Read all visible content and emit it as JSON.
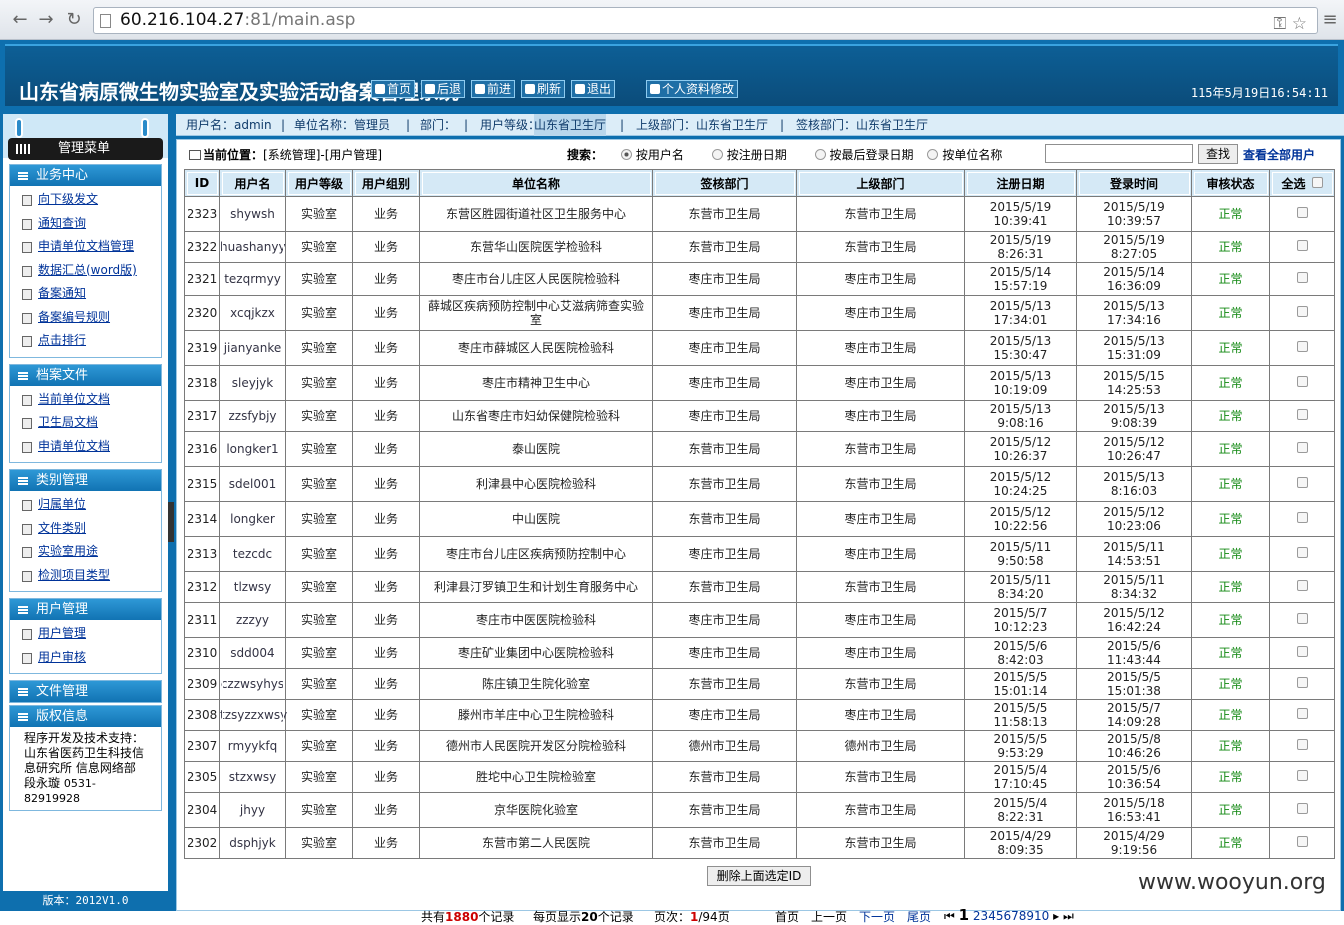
{
  "browser": {
    "url_host": "60.216.104.27",
    "url_rest": ":81/main.asp"
  },
  "header": {
    "title": "山东省病原微生物实验室及实验活动备案管理系统",
    "buttons": [
      "首页",
      "后退",
      "前进",
      "刷新",
      "退出"
    ],
    "profile_button": "个人资料修改",
    "time": "115年5月19日16:54:11"
  },
  "sidebar": {
    "menu_title": "管理菜单",
    "groups": [
      {
        "title": "业务中心",
        "items": [
          "向下级发文",
          "通知查询",
          "申请单位文档管理",
          "数据汇总(word版)",
          "备案通知",
          "备案编号规则",
          "点击排行"
        ]
      },
      {
        "title": "档案文件",
        "items": [
          "当前单位文档",
          "卫生局文档",
          "申请单位文档"
        ]
      },
      {
        "title": "类别管理",
        "items": [
          "归属单位",
          "文件类别",
          "实验室用途",
          "检测项目类型"
        ]
      },
      {
        "title": "用户管理",
        "items": [
          "用户管理",
          "用户审核"
        ]
      },
      {
        "title": "文件管理",
        "items": []
      },
      {
        "title": "版权信息",
        "items": []
      }
    ],
    "credit": "程序开发及技术支持：山东省医药卫生科技信息研究所 信息网络部 段永璇",
    "phone": "0531-82919928",
    "version": "版本：2012V1.0"
  },
  "info": {
    "username": "用户名：admin",
    "unit_name": "单位名称：管理员",
    "dept": "部门：",
    "level_label": "用户等级：",
    "level": "山东省卫生厅",
    "parent_dept": "上级部门：山东省卫生厅",
    "sign_dept": "签核部门：山东省卫生厅"
  },
  "main": {
    "loc_label": "当前位置：",
    "loc_path": "[系统管理]-[用户管理]",
    "search_label": "搜索：",
    "search_options": [
      "按用户名",
      "按注册日期",
      "按最后登录日期",
      "按单位名称"
    ],
    "search_button": "查找",
    "view_all": "查看全部用户",
    "delete_button": "删除上面选定ID"
  },
  "table": {
    "headers": [
      "ID",
      "用户名",
      "用户等级",
      "用户组别",
      "单位名称",
      "签核部门",
      "上级部门",
      "注册日期",
      "登录时间",
      "审核状态",
      "全选"
    ],
    "rows": [
      [
        "2323",
        "shywsh",
        "实验室",
        "业务",
        "东营区胜园街道社区卫生服务中心",
        "东营市卫生局",
        "东营市卫生局",
        "2015/5/19 10:39:41",
        "2015/5/19 10:39:57",
        "正常"
      ],
      [
        "2322",
        "huashanyy",
        "实验室",
        "业务",
        "东营华山医院医学检验科",
        "东营市卫生局",
        "东营市卫生局",
        "2015/5/19 8:26:31",
        "2015/5/19 8:27:05",
        "正常"
      ],
      [
        "2321",
        "tezqrmyy",
        "实验室",
        "业务",
        "枣庄市台儿庄区人民医院检验科",
        "枣庄市卫生局",
        "枣庄市卫生局",
        "2015/5/14 15:57:19",
        "2015/5/14 16:36:09",
        "正常"
      ],
      [
        "2320",
        "xcqjkzx",
        "实验室",
        "业务",
        "薛城区疾病预防控制中心艾滋病筛查实验室",
        "枣庄市卫生局",
        "枣庄市卫生局",
        "2015/5/13 17:34:01",
        "2015/5/13 17:34:16",
        "正常"
      ],
      [
        "2319",
        "jianyanke",
        "实验室",
        "业务",
        "枣庄市薛城区人民医院检验科",
        "枣庄市卫生局",
        "枣庄市卫生局",
        "2015/5/13 15:30:47",
        "2015/5/13 15:31:09",
        "正常"
      ],
      [
        "2318",
        "sleyjyk",
        "实验室",
        "业务",
        "枣庄市精神卫生中心",
        "枣庄市卫生局",
        "枣庄市卫生局",
        "2015/5/13 10:19:09",
        "2015/5/15 14:25:53",
        "正常"
      ],
      [
        "2317",
        "zzsfybjy",
        "实验室",
        "业务",
        "山东省枣庄市妇幼保健院检验科",
        "枣庄市卫生局",
        "枣庄市卫生局",
        "2015/5/13 9:08:16",
        "2015/5/13 9:08:39",
        "正常"
      ],
      [
        "2316",
        "longker1",
        "实验室",
        "业务",
        "泰山医院",
        "东营市卫生局",
        "东营市卫生局",
        "2015/5/12 10:26:37",
        "2015/5/12 10:26:47",
        "正常"
      ],
      [
        "2315",
        "sdel001",
        "实验室",
        "业务",
        "利津县中心医院检验科",
        "东营市卫生局",
        "东营市卫生局",
        "2015/5/12 10:24:25",
        "2015/5/13 8:16:03",
        "正常"
      ],
      [
        "2314",
        "longker",
        "实验室",
        "业务",
        "中山医院",
        "东营市卫生局",
        "枣庄市卫生局",
        "2015/5/12 10:22:56",
        "2015/5/12 10:23:06",
        "正常"
      ],
      [
        "2313",
        "tezcdc",
        "实验室",
        "业务",
        "枣庄市台儿庄区疾病预防控制中心",
        "枣庄市卫生局",
        "枣庄市卫生局",
        "2015/5/11 9:50:58",
        "2015/5/11 14:53:51",
        "正常"
      ],
      [
        "2312",
        "tlzwsy",
        "实验室",
        "业务",
        "利津县汀罗镇卫生和计划生育服务中心",
        "东营市卫生局",
        "东营市卫生局",
        "2015/5/11 8:34:20",
        "2015/5/11 8:34:32",
        "正常"
      ],
      [
        "2311",
        "zzzyy",
        "实验室",
        "业务",
        "枣庄市中医医院检验科",
        "枣庄市卫生局",
        "枣庄市卫生局",
        "2015/5/7 10:12:23",
        "2015/5/12 16:42:24",
        "正常"
      ],
      [
        "2310",
        "sdd004",
        "实验室",
        "业务",
        "枣庄矿业集团中心医院检验科",
        "枣庄市卫生局",
        "枣庄市卫生局",
        "2015/5/6 8:42:03",
        "2015/5/6 11:43:44",
        "正常"
      ],
      [
        "2309",
        "czzwsyhys",
        "实验室",
        "业务",
        "陈庄镇卫生院化验室",
        "东营市卫生局",
        "东营市卫生局",
        "2015/5/5 15:01:14",
        "2015/5/5 15:01:38",
        "正常"
      ],
      [
        "2308",
        "tzsyzzxwsy",
        "实验室",
        "业务",
        "滕州市羊庄中心卫生院检验科",
        "枣庄市卫生局",
        "枣庄市卫生局",
        "2015/5/5 11:58:13",
        "2015/5/7 14:09:28",
        "正常"
      ],
      [
        "2307",
        "rmyykfq",
        "实验室",
        "业务",
        "德州市人民医院开发区分院检验科",
        "德州市卫生局",
        "德州市卫生局",
        "2015/5/5 9:53:29",
        "2015/5/8 10:46:26",
        "正常"
      ],
      [
        "2305",
        "stzxwsy",
        "实验室",
        "业务",
        "胜坨中心卫生院检验室",
        "东营市卫生局",
        "东营市卫生局",
        "2015/5/4 17:10:45",
        "2015/5/6 10:36:54",
        "正常"
      ],
      [
        "2304",
        "jhyy",
        "实验室",
        "业务",
        "京华医院化验室",
        "东营市卫生局",
        "东营市卫生局",
        "2015/5/4 8:22:31",
        "2015/5/18 16:53:41",
        "正常"
      ],
      [
        "2302",
        "dsphjyk",
        "实验室",
        "业务",
        "东营市第二人民医院",
        "东营市卫生局",
        "东营市卫生局",
        "2015/4/29 8:09:35",
        "2015/4/29 9:19:56",
        "正常"
      ]
    ]
  },
  "pager": {
    "total_pre": "共有",
    "total": "1880",
    "total_post": "个记录",
    "perpage_pre": "每页显示",
    "perpage": "20",
    "perpage_post": "个记录",
    "page_pre": "页次：",
    "page_cur": "1",
    "page_total": "/94页",
    "first": "首页",
    "prev": "上一页",
    "next": "下一页",
    "last": "尾页",
    "pages": [
      "1",
      "2",
      "3",
      "4",
      "5",
      "6",
      "7",
      "8",
      "9",
      "10"
    ]
  },
  "watermark": "www.wooyun.org"
}
